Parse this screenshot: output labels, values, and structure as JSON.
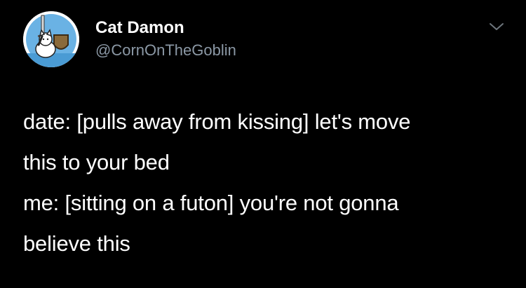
{
  "tweet": {
    "author": {
      "display_name": "Cat Damon",
      "handle": "@CornOnTheGoblin",
      "avatar_icon": "cat-knight-avatar"
    },
    "menu_icon": "chevron-down-icon",
    "text_lines": [
      "date: [pulls away from kissing] let's move",
      "this to your bed",
      "me: [sitting on a futon] you're not gonna",
      "believe this"
    ]
  },
  "colors": {
    "background": "#000000",
    "text": "#ffffff",
    "secondary_text": "#8b98a5",
    "avatar_bg": "#ffffff",
    "avatar_ring": "#6ab2e4"
  }
}
